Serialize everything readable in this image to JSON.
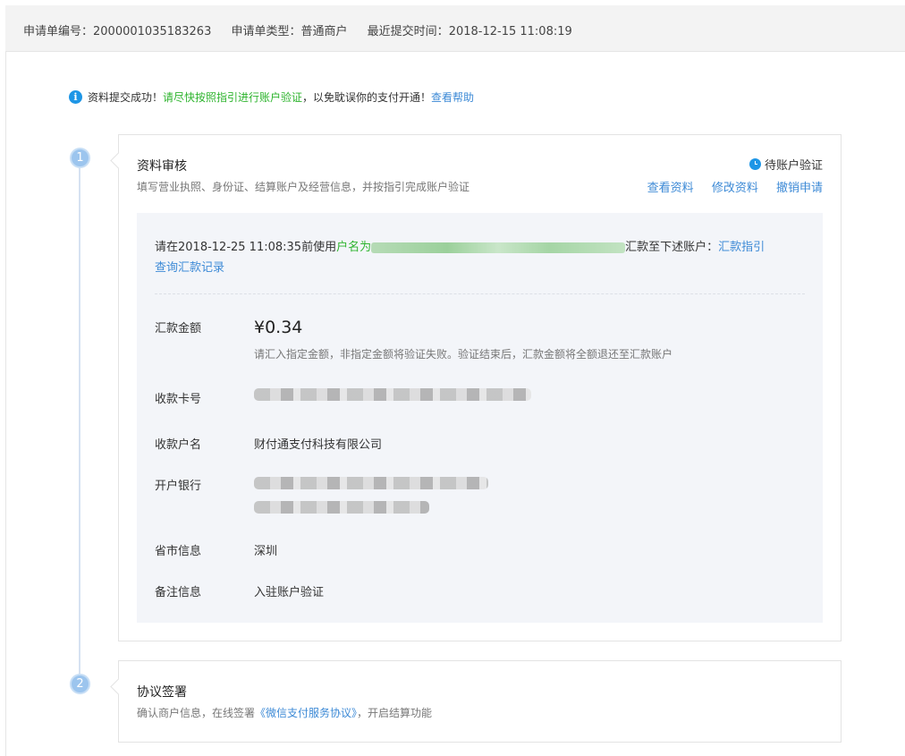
{
  "header": {
    "app_no_label": "申请单编号：",
    "app_no": "2000001035183263",
    "app_type_label": "申请单类型：",
    "app_type": "普通商户",
    "submit_time_label": "最近提交时间：",
    "submit_time": "2018-12-15 11:08:19"
  },
  "notice": {
    "icon": "info-icon",
    "prefix": "资料提交成功！",
    "green_text": "请尽快按照指引进行账户验证",
    "suffix": "，以免耽误你的支付开通！",
    "help_link": "查看帮助"
  },
  "steps": [
    {
      "number": "1",
      "title": "资料审核",
      "subtitle": "填写营业执照、身份证、结算账户及经营信息，并按指引完成账户验证",
      "status": "待账户验证",
      "actions": [
        "查看资料",
        "修改资料",
        "撤销申请"
      ]
    },
    {
      "number": "2",
      "title": "协议签署",
      "subtitle_prefix": "确认商户信息，在线签署",
      "subtitle_link": "《微信支付服务协议》",
      "subtitle_suffix": "，开启结算功能"
    }
  ],
  "transfer": {
    "instruction_prefix": "请在2018-12-25 11:08:35前使用",
    "account_label": "户名为",
    "instruction_suffix": "汇款至下述账户：",
    "guide_link": "汇款指引",
    "records_link": "查询汇款记录",
    "fields": [
      {
        "label": "汇款金额",
        "value": "¥0.34"
      },
      {
        "label": "收款卡号",
        "value": ""
      },
      {
        "label": "收款户名",
        "value": "财付通支付科技有限公司"
      },
      {
        "label": "开户银行",
        "value": ""
      },
      {
        "label": "省市信息",
        "value": "深圳"
      },
      {
        "label": "备注信息",
        "value": "入驻账户验证"
      }
    ],
    "amount_hint": "请汇入指定金额，非指定金额将验证失败。验证结束后，汇款金额将全额退还至汇款账户"
  },
  "colors": {
    "link": "#3d8ad6",
    "green": "#2eb42e",
    "accent": "#1e96e6",
    "panel_bg": "#f3f5f9"
  }
}
